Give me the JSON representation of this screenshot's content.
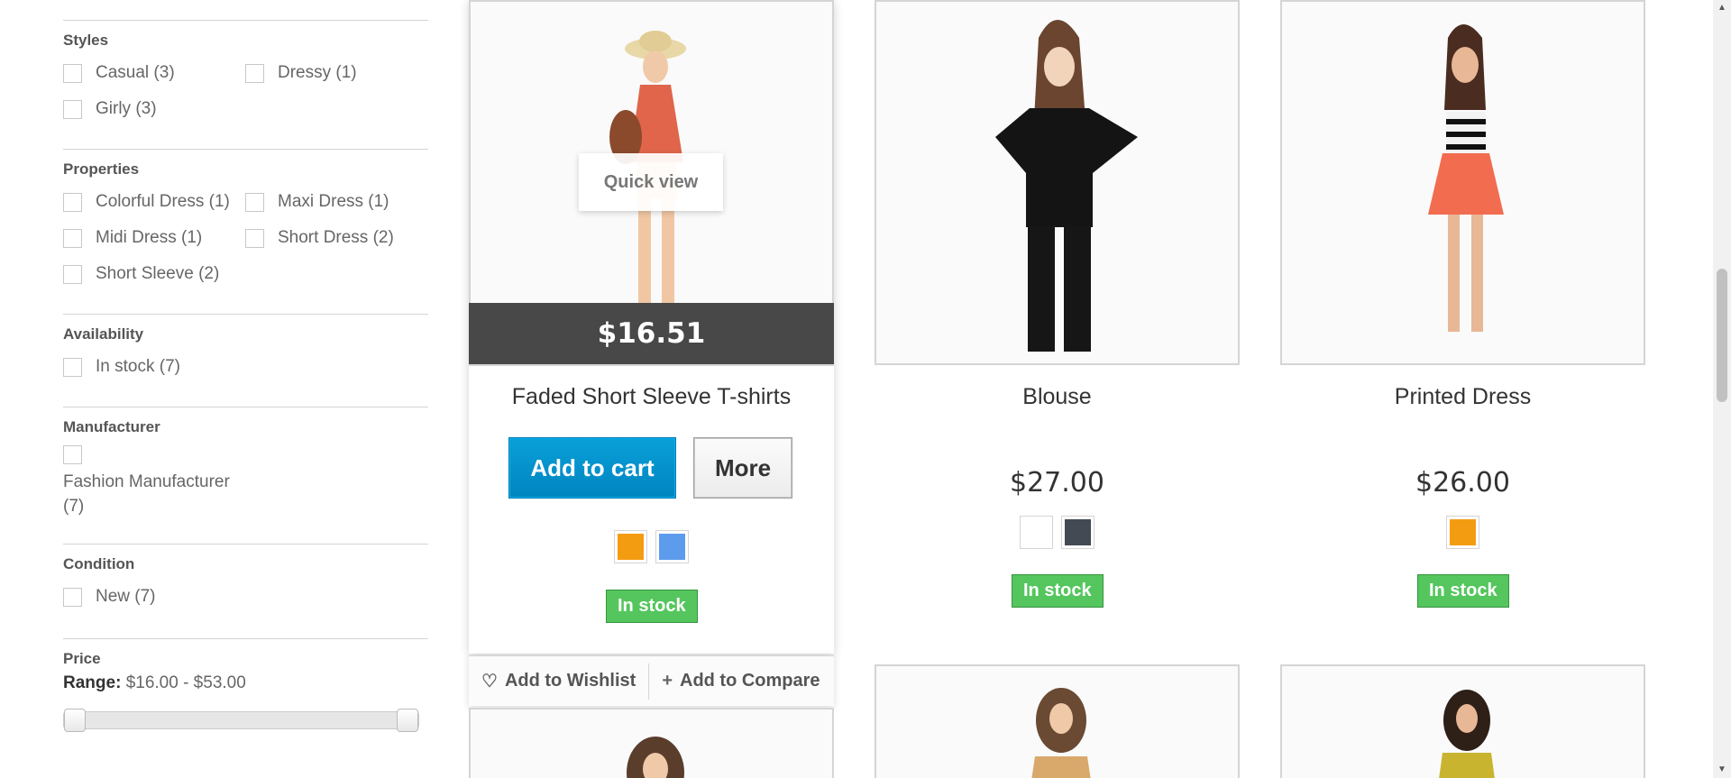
{
  "filters": {
    "styles": {
      "title": "Styles",
      "items": [
        "Casual (3)",
        "Dressy (1)",
        "Girly (3)"
      ]
    },
    "properties": {
      "title": "Properties",
      "items": [
        "Colorful Dress (1)",
        "Maxi Dress (1)",
        "Midi Dress (1)",
        "Short Dress (2)",
        "Short Sleeve (2)"
      ]
    },
    "availability": {
      "title": "Availability",
      "items": [
        "In stock (7)"
      ]
    },
    "manufacturer": {
      "title": "Manufacturer",
      "item_line1": "Fashion Manufacturer",
      "item_line2": "(7)"
    },
    "condition": {
      "title": "Condition",
      "items": [
        "New (7)"
      ]
    },
    "price": {
      "title": "Price",
      "range_label": "Range:",
      "range_value": "$16.00 - $53.00",
      "slider_min_fraction": 0,
      "slider_max_fraction": 1
    }
  },
  "products": [
    {
      "name": "Faded Short Sleeve T-shirts",
      "price": "$16.51",
      "quick_view": "Quick view",
      "add_to_cart": "Add to cart",
      "more": "More",
      "colors": [
        "#f39c11",
        "#5d9cec"
      ],
      "stock": "In stock",
      "wishlist": "Add to Wishlist",
      "compare": "Add to Compare"
    },
    {
      "name": "Blouse",
      "price": "$27.00",
      "colors": [
        "#ffffff",
        "#434a54"
      ],
      "stock": "In stock"
    },
    {
      "name": "Printed Dress",
      "price": "$26.00",
      "colors": [
        "#f39c11"
      ],
      "stock": "In stock"
    }
  ],
  "icons": {
    "wishlist": "heart-icon",
    "compare": "plus-icon"
  },
  "colors": {
    "stock_green": "#55c65e",
    "cart_blue": "#0085c0",
    "price_bar": "#484848"
  }
}
